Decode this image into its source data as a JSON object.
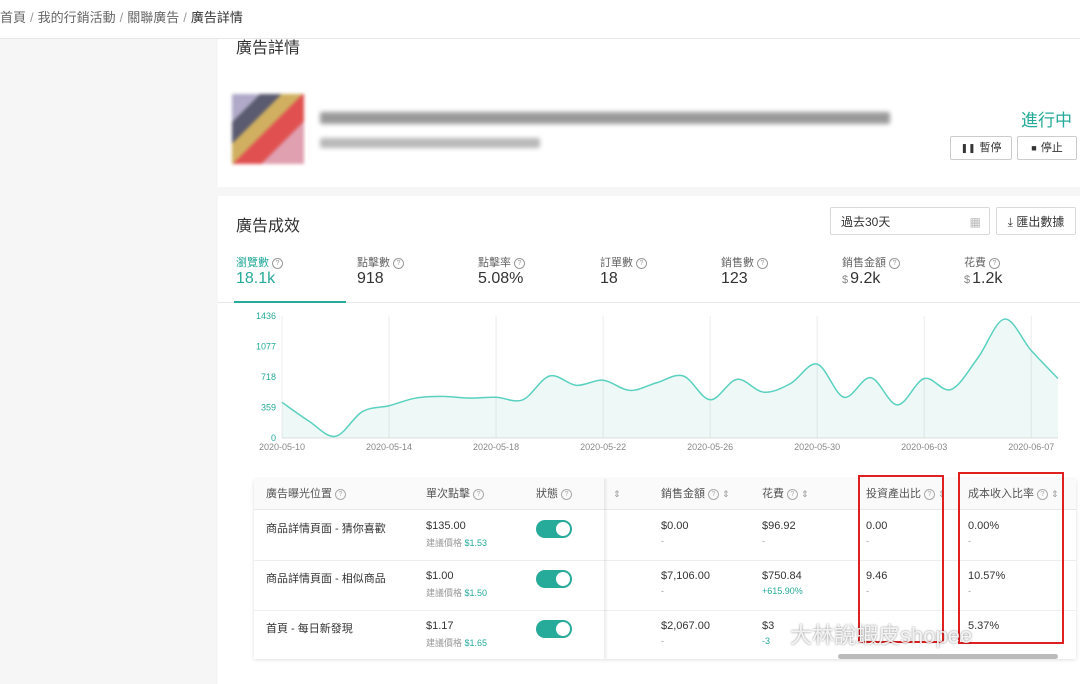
{
  "breadcrumb": {
    "items": [
      "首頁",
      "我的行銷活動",
      "關聯廣告"
    ],
    "current": "廣告詳情",
    "separator": "/"
  },
  "detail": {
    "title": "廣告詳情",
    "status": "進行中",
    "pause_label": "暫停",
    "stop_label": "停止"
  },
  "performance": {
    "title": "廣告成效",
    "date_range": "過去30天",
    "export_label": "匯出數據",
    "metrics": [
      {
        "label": "瀏覽數",
        "value": "18.1k",
        "currency": ""
      },
      {
        "label": "點擊數",
        "value": "918",
        "currency": ""
      },
      {
        "label": "點擊率",
        "value": "5.08%",
        "currency": ""
      },
      {
        "label": "訂單數",
        "value": "18",
        "currency": ""
      },
      {
        "label": "銷售數",
        "value": "123",
        "currency": ""
      },
      {
        "label": "銷售金額",
        "value": "9.2k",
        "currency": "$"
      },
      {
        "label": "花費",
        "value": "1.2k",
        "currency": "$"
      }
    ]
  },
  "chart_data": {
    "type": "area",
    "title": "",
    "xlabel": "",
    "ylabel": "",
    "ylim": [
      0,
      1436
    ],
    "yticks": [
      0,
      359,
      718,
      1077,
      1436
    ],
    "xticks": [
      "2020-05-10",
      "2020-05-14",
      "2020-05-18",
      "2020-05-22",
      "2020-05-26",
      "2020-05-30",
      "2020-06-03",
      "2020-06-07"
    ],
    "grid": true,
    "accent": "#26aa99",
    "series": [
      {
        "x": [
          "2020-05-10",
          "2020-05-11",
          "2020-05-12",
          "2020-05-13",
          "2020-05-14",
          "2020-05-15",
          "2020-05-16",
          "2020-05-17",
          "2020-05-18",
          "2020-05-19",
          "2020-05-20",
          "2020-05-21",
          "2020-05-22",
          "2020-05-23",
          "2020-05-24",
          "2020-05-25",
          "2020-05-26",
          "2020-05-27",
          "2020-05-28",
          "2020-05-29",
          "2020-05-30",
          "2020-05-31",
          "2020-06-01",
          "2020-06-02",
          "2020-06-03",
          "2020-06-04",
          "2020-06-05",
          "2020-06-06",
          "2020-06-07",
          "2020-06-08"
        ],
        "values": [
          420,
          200,
          20,
          310,
          380,
          470,
          490,
          470,
          480,
          450,
          730,
          620,
          680,
          560,
          650,
          730,
          450,
          690,
          540,
          640,
          870,
          480,
          710,
          390,
          700,
          570,
          940,
          1400,
          1030,
          700
        ]
      }
    ]
  },
  "table": {
    "columns": [
      {
        "label": "廣告曝光位置",
        "sort": false
      },
      {
        "label": "單次點擊",
        "sort": false
      },
      {
        "label": "狀態",
        "sort": false
      },
      {
        "label": "",
        "sort": true
      },
      {
        "label": "銷售金額",
        "sort": true
      },
      {
        "label": "花費",
        "sort": true
      },
      {
        "label": "投資產出比",
        "sort": true
      },
      {
        "label": "成本收入比率",
        "sort": true
      }
    ],
    "rows": [
      {
        "placement": "商品詳情頁面 - 猜你喜歡",
        "cpc": "$135.00",
        "suggested_label": "建議價格",
        "suggested": "$1.53",
        "sales": "$0.00",
        "sales_sub": "-",
        "spend": "$96.92",
        "spend_sub": "-",
        "roas": "0.00",
        "roas_sub": "-",
        "acos": "0.00%",
        "acos_sub": "-"
      },
      {
        "placement": "商品詳情頁面 - 相似商品",
        "cpc": "$1.00",
        "suggested_label": "建議價格",
        "suggested": "$1.50",
        "sales": "$7,106.00",
        "sales_sub": "-",
        "spend": "$750.84",
        "spend_sub": "+615.90%",
        "roas": "9.46",
        "roas_sub": "-",
        "acos": "10.57%",
        "acos_sub": "-"
      },
      {
        "placement": "首頁 - 每日新發現",
        "cpc": "$1.17",
        "suggested_label": "建議價格",
        "suggested": "$1.65",
        "sales": "$2,067.00",
        "sales_sub": "-",
        "spend": "$3",
        "spend_sub": "-3",
        "roas": "",
        "roas_sub": "",
        "acos": "5.37%",
        "acos_sub": ""
      }
    ]
  },
  "watermark": "大林說蝦皮shopee"
}
